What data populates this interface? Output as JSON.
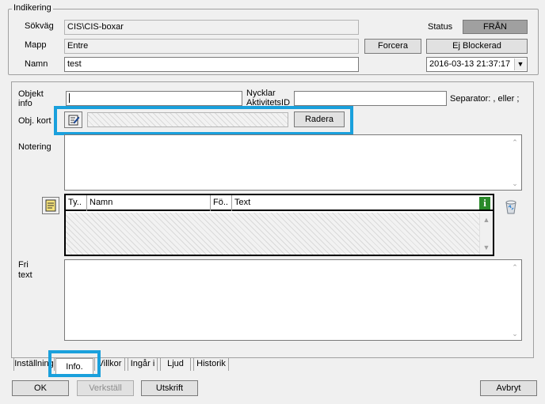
{
  "indikering": {
    "legend": "Indikering",
    "sokvag_label": "Sökväg",
    "sokvag_value": "CIS\\CIS-boxar",
    "mapp_label": "Mapp",
    "mapp_value": "Entre",
    "namn_label": "Namn",
    "namn_value": "test",
    "status_label": "Status",
    "status_value": "FRÅN",
    "forcera_label": "Forcera",
    "blockerad_label": "Ej Blockerad",
    "datetime_value": "2016-03-13  21:37:17"
  },
  "info": {
    "objekt_label_1": "Objekt",
    "objekt_label_2": "info",
    "objekt_value": "",
    "nycklar_label_1": "Nycklar",
    "nycklar_label_2": "AktivitetsID",
    "nycklar_value": "",
    "separator_label": "Separator: , eller ;",
    "objkort_label": "Obj. kort",
    "radera_label": "Radera",
    "notering_label": "Notering",
    "notering_value": "",
    "table_columns": [
      "Ty..",
      "Namn",
      "Fö..",
      "Text"
    ],
    "fri_label_1": "Fri",
    "fri_label_2": "text",
    "fri_value": ""
  },
  "tabs": [
    "Inställning",
    "Info.",
    "Villkor",
    "Ingår i",
    "Ljud",
    "Historik"
  ],
  "active_tab": "Info.",
  "buttons": {
    "ok": "OK",
    "verkstall": "Verkställ",
    "utskrift": "Utskrift",
    "avbryt": "Avbryt"
  },
  "colors": {
    "highlight": "#1aa0dc",
    "status_bg": "#a0a0a0",
    "dialog_bg": "#f0f0f0"
  },
  "icons": {
    "edit": "edit-note-icon",
    "notes": "notepad-icon",
    "info": "info-icon",
    "recycle": "recycle-bin-icon"
  }
}
